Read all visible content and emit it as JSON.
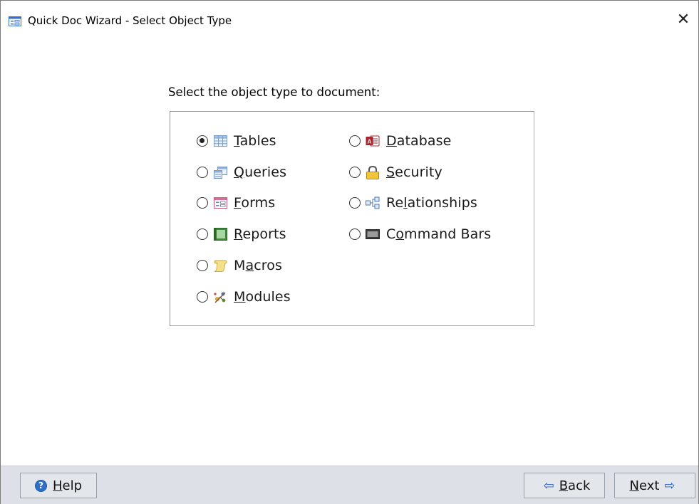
{
  "window": {
    "title": "Quick Doc Wizard - Select Object Type",
    "close_glyph": "✕"
  },
  "prompt": "Select the object type to document:",
  "options_left": [
    {
      "pre": "",
      "key": "T",
      "post": "ables",
      "icon": "table-icon",
      "selected": true
    },
    {
      "pre": "",
      "key": "Q",
      "post": "ueries",
      "icon": "query-icon",
      "selected": false
    },
    {
      "pre": "",
      "key": "F",
      "post": "orms",
      "icon": "form-icon",
      "selected": false
    },
    {
      "pre": "",
      "key": "R",
      "post": "eports",
      "icon": "report-icon",
      "selected": false
    },
    {
      "pre": "M",
      "key": "a",
      "post": "cros",
      "icon": "macro-icon",
      "selected": false
    },
    {
      "pre": "",
      "key": "M",
      "post": "odules",
      "icon": "module-icon",
      "selected": false
    }
  ],
  "options_right": [
    {
      "pre": "",
      "key": "D",
      "post": "atabase",
      "icon": "database-icon",
      "selected": false
    },
    {
      "pre": "",
      "key": "S",
      "post": "ecurity",
      "icon": "lock-icon",
      "selected": false
    },
    {
      "pre": "Re",
      "key": "l",
      "post": "ationships",
      "icon": "relationships-icon",
      "selected": false
    },
    {
      "pre": "C",
      "key": "o",
      "post": "mmand Bars",
      "icon": "command-bar-icon",
      "selected": false
    }
  ],
  "footer": {
    "help": {
      "key": "H",
      "post": "elp"
    },
    "back": {
      "key": "B",
      "post": "ack"
    },
    "next": {
      "key": "N",
      "post": "ext"
    }
  },
  "colors": {
    "footer_bg": "#dde1e7",
    "accent": "#2b65c2"
  }
}
